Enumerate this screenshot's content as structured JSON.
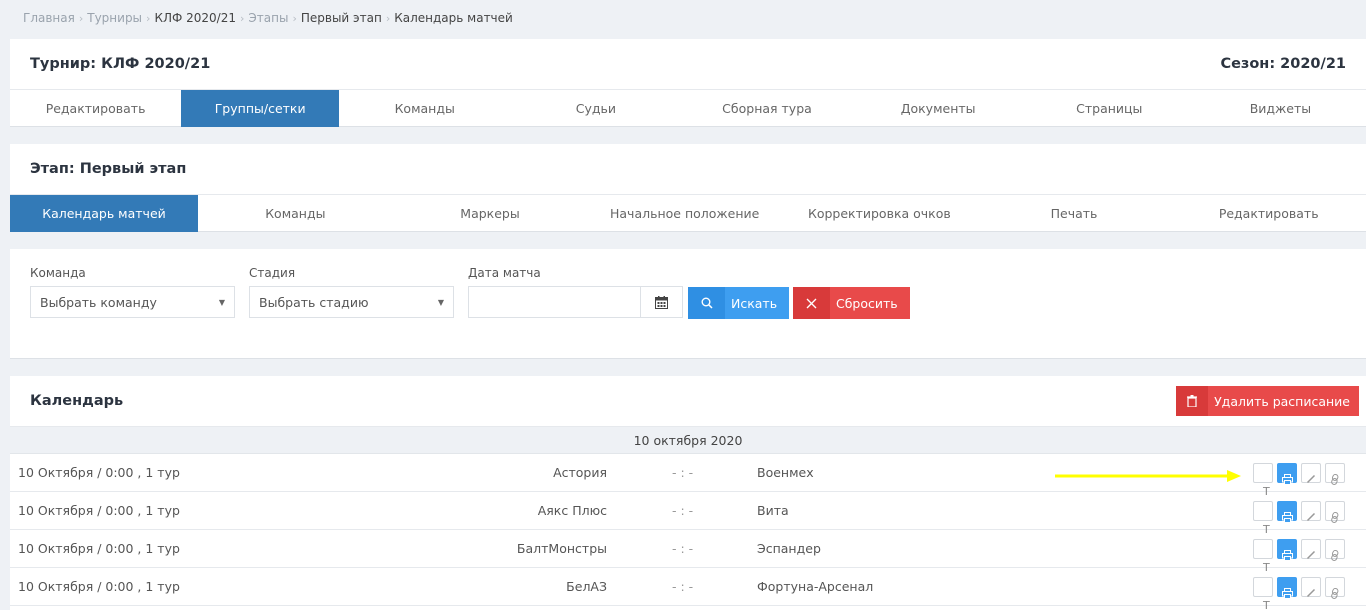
{
  "breadcrumb": [
    "Главная",
    "Турниры",
    "КЛФ 2020/21",
    "Этапы",
    "Первый этап",
    "Календарь матчей"
  ],
  "tournament": {
    "title": "Турнир: КЛФ 2020/21",
    "season": "Сезон: 2020/21",
    "tabs": [
      "Редактировать",
      "Группы/сетки",
      "Команды",
      "Судьи",
      "Сборная тура",
      "Документы",
      "Страницы",
      "Виджеты"
    ],
    "active_tab": "Группы/сетки"
  },
  "stage": {
    "title": "Этап: Первый этап",
    "tabs": [
      "Календарь матчей",
      "Команды",
      "Маркеры",
      "Начальное положение",
      "Корректировка очков",
      "Печать",
      "Редактировать"
    ],
    "active_tab": "Календарь матчей"
  },
  "filters": {
    "team_label": "Команда",
    "team_value": "Выбрать команду",
    "stage_label": "Стадия",
    "stage_value": "Выбрать стадию",
    "date_label": "Дата матча",
    "date_value": "",
    "search_button": "Искать",
    "reset_button": "Сбросить"
  },
  "calendar": {
    "title": "Календарь",
    "delete_button": "Удалить расписание",
    "date_group": "10 октября 2020",
    "matches": [
      {
        "date": "10 Октября / 0:00 , 1 тур",
        "home": "Астория",
        "score": "- : -",
        "away": "Военмех"
      },
      {
        "date": "10 Октября / 0:00 , 1 тур",
        "home": "Аякс Плюс",
        "score": "- : -",
        "away": "Вита"
      },
      {
        "date": "10 Октября / 0:00 , 1 тур",
        "home": "БалтМонстры",
        "score": "- : -",
        "away": "Эспандер"
      },
      {
        "date": "10 Октября / 0:00 , 1 тур",
        "home": "БелАЗ",
        "score": "- : -",
        "away": "Фортуна-Арсенал"
      }
    ],
    "action_icons": [
      "text-icon",
      "print-icon",
      "edit-icon",
      "link-icon"
    ],
    "action_text_glyph": "T"
  },
  "colors": {
    "primary": "#337ab7",
    "search": "#3e9ef0",
    "danger": "#e84a4a",
    "annotation_arrow": "#ffff00"
  }
}
